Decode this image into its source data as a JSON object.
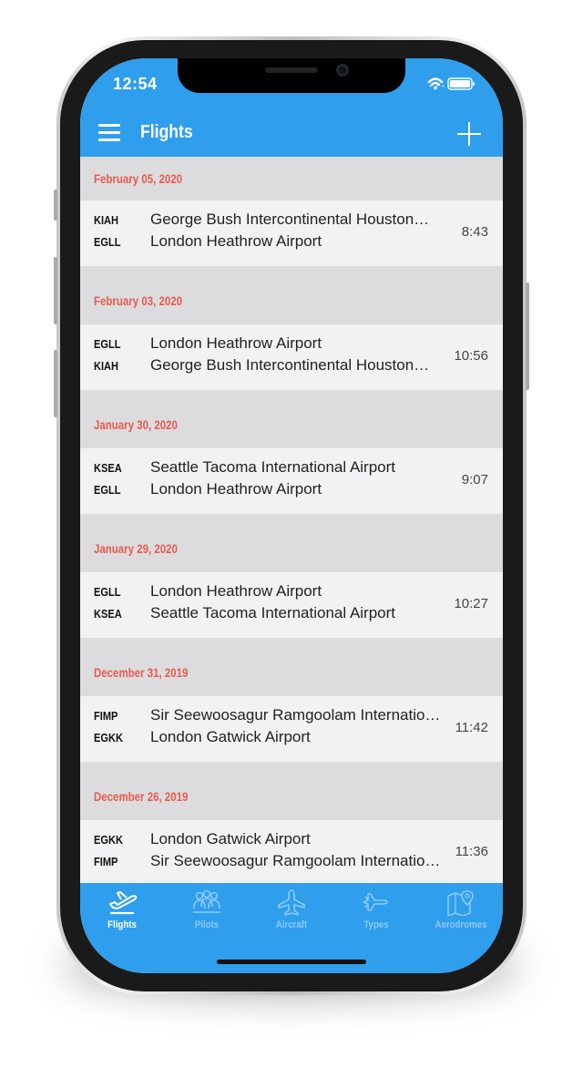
{
  "status": {
    "time": "12:54"
  },
  "header": {
    "title": "Flights"
  },
  "sections": [
    {
      "date": "February 05, 2020",
      "flight": {
        "from_code": "KIAH",
        "from_name": "George Bush Intercontinental Houston…",
        "to_code": "EGLL",
        "to_name": "London Heathrow Airport",
        "duration": "8:43"
      }
    },
    {
      "date": "February 03, 2020",
      "flight": {
        "from_code": "EGLL",
        "from_name": "London Heathrow Airport",
        "to_code": "KIAH",
        "to_name": "George Bush Intercontinental Houston…",
        "duration": "10:56"
      }
    },
    {
      "date": "January 30, 2020",
      "flight": {
        "from_code": "KSEA",
        "from_name": "Seattle Tacoma International Airport",
        "to_code": "EGLL",
        "to_name": "London Heathrow Airport",
        "duration": "9:07"
      }
    },
    {
      "date": "January 29, 2020",
      "flight": {
        "from_code": "EGLL",
        "from_name": "London Heathrow Airport",
        "to_code": "KSEA",
        "to_name": "Seattle Tacoma International Airport",
        "duration": "10:27"
      }
    },
    {
      "date": "December 31, 2019",
      "flight": {
        "from_code": "FIMP",
        "from_name": "Sir Seewoosagur Ramgoolam Internatio…",
        "to_code": "EGKK",
        "to_name": "London Gatwick Airport",
        "duration": "11:42"
      }
    },
    {
      "date": "December 26, 2019",
      "flight": {
        "from_code": "EGKK",
        "from_name": "London Gatwick Airport",
        "to_code": "FIMP",
        "to_name": "Sir Seewoosagur Ramgoolam Internatio…",
        "duration": "11:36"
      }
    }
  ],
  "tabs": [
    {
      "label": "Flights",
      "icon": "plane-takeoff-icon",
      "active": true
    },
    {
      "label": "Pilots",
      "icon": "people-icon",
      "active": false
    },
    {
      "label": "Aircraft",
      "icon": "airplane-icon",
      "active": false
    },
    {
      "label": "Types",
      "icon": "jet-icon",
      "active": false
    },
    {
      "label": "Aerodromes",
      "icon": "map-pin-icon",
      "active": false
    }
  ],
  "colors": {
    "accent": "#2f9eed",
    "date_text": "#e85a4f",
    "section_bg": "#dcdcde",
    "row_bg": "#f2f2f4",
    "inactive_tab": "#8ccaf6"
  }
}
